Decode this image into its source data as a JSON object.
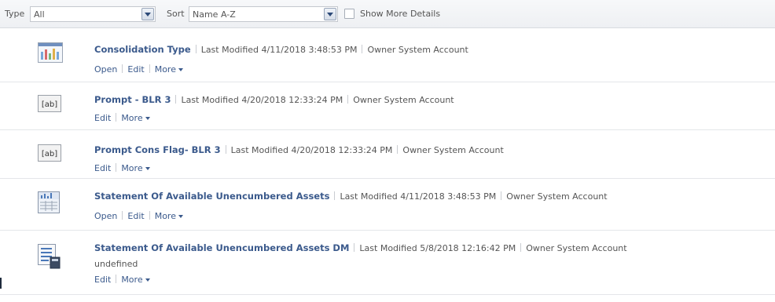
{
  "toolbar": {
    "type_label": "Type",
    "type_value": "All",
    "sort_label": "Sort",
    "sort_value": "Name A-Z",
    "show_more_label": "Show More Details"
  },
  "labels": {
    "last_modified": "Last Modified",
    "owner": "Owner",
    "open": "Open",
    "edit": "Edit",
    "more": "More"
  },
  "items": [
    {
      "title": "Consolidation Type",
      "modified": "4/11/2018 3:48:53 PM",
      "owner": "System Account",
      "icon": "dashboard-icon",
      "subtext": ""
    },
    {
      "title": "Prompt - BLR 3",
      "modified": "4/20/2018 12:33:24 PM",
      "owner": "System Account",
      "icon": "prompt-icon",
      "subtext": ""
    },
    {
      "title": "Prompt Cons Flag- BLR 3",
      "modified": "4/20/2018 12:33:24 PM",
      "owner": "System Account",
      "icon": "prompt-icon",
      "subtext": ""
    },
    {
      "title": "Statement Of Available Unencumbered Assets",
      "modified": "4/11/2018 3:48:53 PM",
      "owner": "System Account",
      "icon": "analysis-icon",
      "subtext": ""
    },
    {
      "title": "Statement Of Available Unencumbered Assets DM",
      "modified": "5/8/2018 12:16:42 PM",
      "owner": "System Account",
      "icon": "data-model-icon",
      "subtext": "undefined"
    }
  ]
}
